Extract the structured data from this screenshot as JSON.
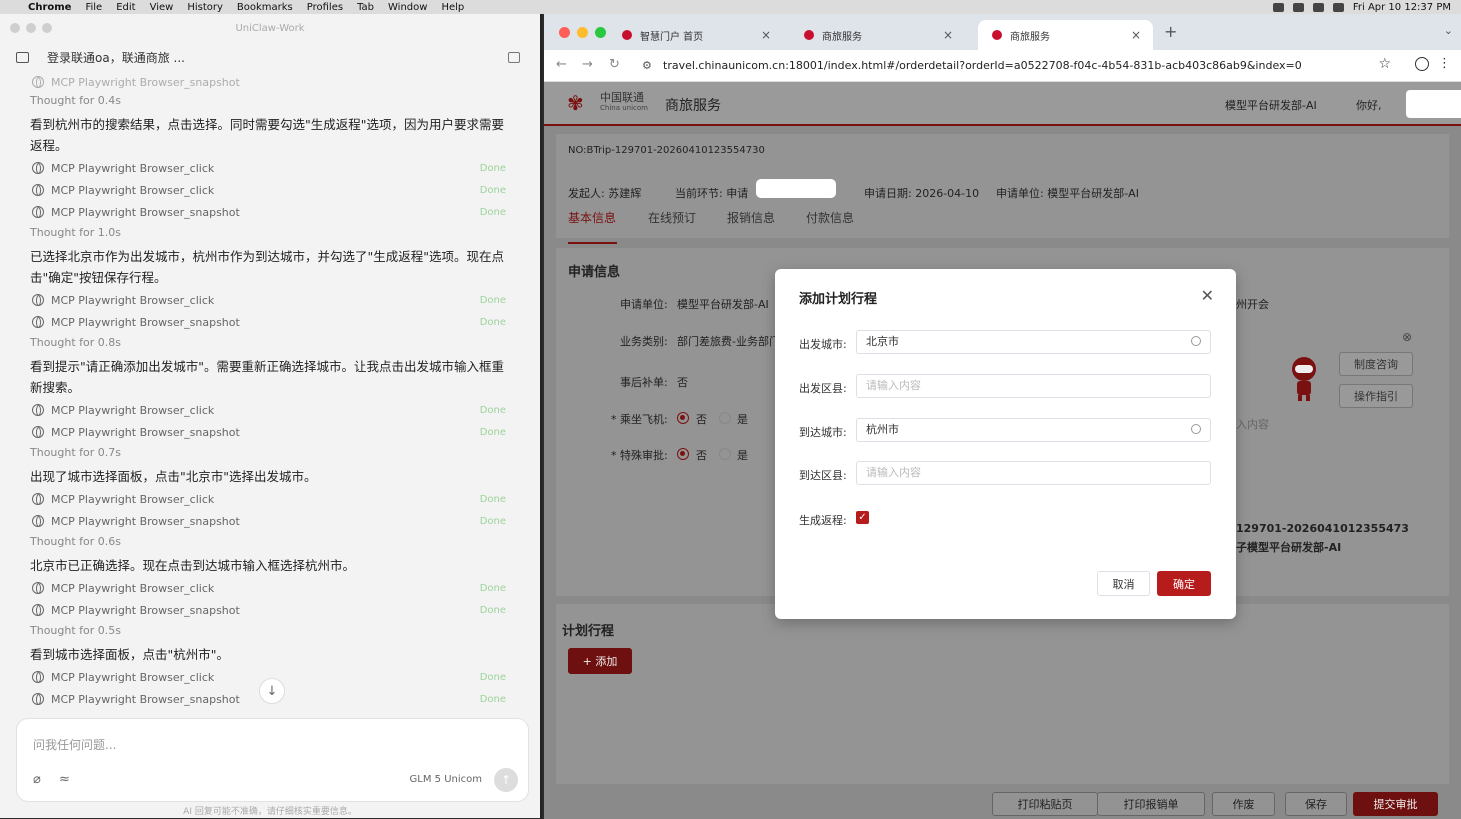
{
  "menubar": {
    "app": "Chrome",
    "items": [
      "File",
      "Edit",
      "View",
      "History",
      "Bookmarks",
      "Profiles",
      "Tab",
      "Window",
      "Help"
    ],
    "clock": "Fri Apr 10  12:37 PM"
  },
  "left": {
    "window_title": "UniClaw-Work",
    "conversation_title": "登录联通oa，联通商旅 ...",
    "partial_top": "MCP Playwright Browser_snapshot",
    "feed": [
      {
        "type": "thought",
        "text": "Thought for 0.4s"
      },
      {
        "type": "msg",
        "text": "看到杭州市的搜索结果，点击选择。同时需要勾选\"生成返程\"选项，因为用户要求需要返程。"
      },
      {
        "type": "tool",
        "text": "MCP Playwright Browser_click",
        "status": "Done"
      },
      {
        "type": "tool",
        "text": "MCP Playwright Browser_click",
        "status": "Done"
      },
      {
        "type": "tool",
        "text": "MCP Playwright Browser_snapshot",
        "status": "Done"
      },
      {
        "type": "thought",
        "text": "Thought for 1.0s"
      },
      {
        "type": "msg",
        "text": "已选择北京市作为出发城市，杭州市作为到达城市，并勾选了\"生成返程\"选项。现在点击\"确定\"按钮保存行程。"
      },
      {
        "type": "tool",
        "text": "MCP Playwright Browser_click",
        "status": "Done"
      },
      {
        "type": "tool",
        "text": "MCP Playwright Browser_snapshot",
        "status": "Done"
      },
      {
        "type": "thought",
        "text": "Thought for 0.8s"
      },
      {
        "type": "msg",
        "text": "看到提示\"请正确添加出发城市\"。需要重新正确选择城市。让我点击出发城市输入框重新搜索。"
      },
      {
        "type": "tool",
        "text": "MCP Playwright Browser_click",
        "status": "Done"
      },
      {
        "type": "tool",
        "text": "MCP Playwright Browser_snapshot",
        "status": "Done"
      },
      {
        "type": "thought",
        "text": "Thought for 0.7s"
      },
      {
        "type": "msg",
        "text": "出现了城市选择面板，点击\"北京市\"选择出发城市。"
      },
      {
        "type": "tool",
        "text": "MCP Playwright Browser_click",
        "status": "Done"
      },
      {
        "type": "tool",
        "text": "MCP Playwright Browser_snapshot",
        "status": "Done"
      },
      {
        "type": "thought",
        "text": "Thought for 0.6s"
      },
      {
        "type": "msg",
        "text": "北京市已正确选择。现在点击到达城市输入框选择杭州市。"
      },
      {
        "type": "tool",
        "text": "MCP Playwright Browser_click",
        "status": "Done"
      },
      {
        "type": "tool",
        "text": "MCP Playwright Browser_snapshot",
        "status": "Done"
      },
      {
        "type": "thought",
        "text": "Thought for 0.5s"
      },
      {
        "type": "msg",
        "text": "看到城市选择面板，点击\"杭州市\"。"
      },
      {
        "type": "tool",
        "text": "MCP Playwright Browser_click",
        "status": "Done"
      },
      {
        "type": "tool",
        "text": "MCP Playwright Browser_snapshot",
        "status": "Done"
      }
    ],
    "composer_placeholder": "问我任何问题...",
    "model": "GLM 5 Unicom",
    "disclaimer": "AI 回复可能不准确，请仔细核实重要信息。"
  },
  "browser": {
    "tabs": [
      {
        "title": "智慧门户 首页"
      },
      {
        "title": "商旅服务"
      },
      {
        "title": "商旅服务"
      }
    ],
    "url": "travel.chinaunicom.cn:18001/index.html#/orderdetail?orderId=a0522708-f04c-4b54-831b-acb403c86ab9&index=0"
  },
  "page": {
    "logo_cn": "中国联通",
    "logo_en": "China unicom",
    "header_title": "商旅服务",
    "dept": "模型平台研发部-AI",
    "greeting": "你好,",
    "order_no": "NO:BTrip-129701-20260410123554730",
    "initiator": "发起人: 苏建辉",
    "current_step": "当前环节: 申请",
    "apply_date": "申请日期: 2026-04-10",
    "apply_unit": "申请单位: 模型平台研发部-AI",
    "tabs": [
      "基本信息",
      "在线预订",
      "报销信息",
      "付款信息"
    ],
    "section_apply": "申请信息",
    "fields": [
      {
        "label": "申请单位:",
        "value": "模型平台研发部-AI"
      },
      {
        "label": "业务类别:",
        "value": "部门差旅费-业务部门"
      },
      {
        "label": "事后补单:",
        "value": "否"
      }
    ],
    "flight_label": "* 乘坐飞机:",
    "special_label": "* 特殊审批:",
    "no": "否",
    "yes": "是",
    "right_text1": "州开会",
    "right_placeholder": "入内容",
    "side_btn1": "制度咨询",
    "side_btn2": "操作指引",
    "right_no": "129701-2026041012355473",
    "right_dept": "子模型平台研发部-AI",
    "section_plan": "计划行程",
    "add_btn": "+ 添加",
    "footer": [
      "打印粘贴页",
      "打印报销单",
      "作废",
      "保存",
      "提交审批"
    ]
  },
  "modal": {
    "title": "添加计划行程",
    "depart_city_label": "出发城市:",
    "depart_city": "北京市",
    "depart_district_label": "出发区县:",
    "depart_district_ph": "请输入内容",
    "arrive_city_label": "到达城市:",
    "arrive_city": "杭州市",
    "arrive_district_label": "到达区县:",
    "arrive_district_ph": "请输入内容",
    "return_label": "生成返程:",
    "cancel": "取消",
    "ok": "确定"
  },
  "colors": {
    "brand": "#b71c1c",
    "done": "#9cd39c"
  }
}
